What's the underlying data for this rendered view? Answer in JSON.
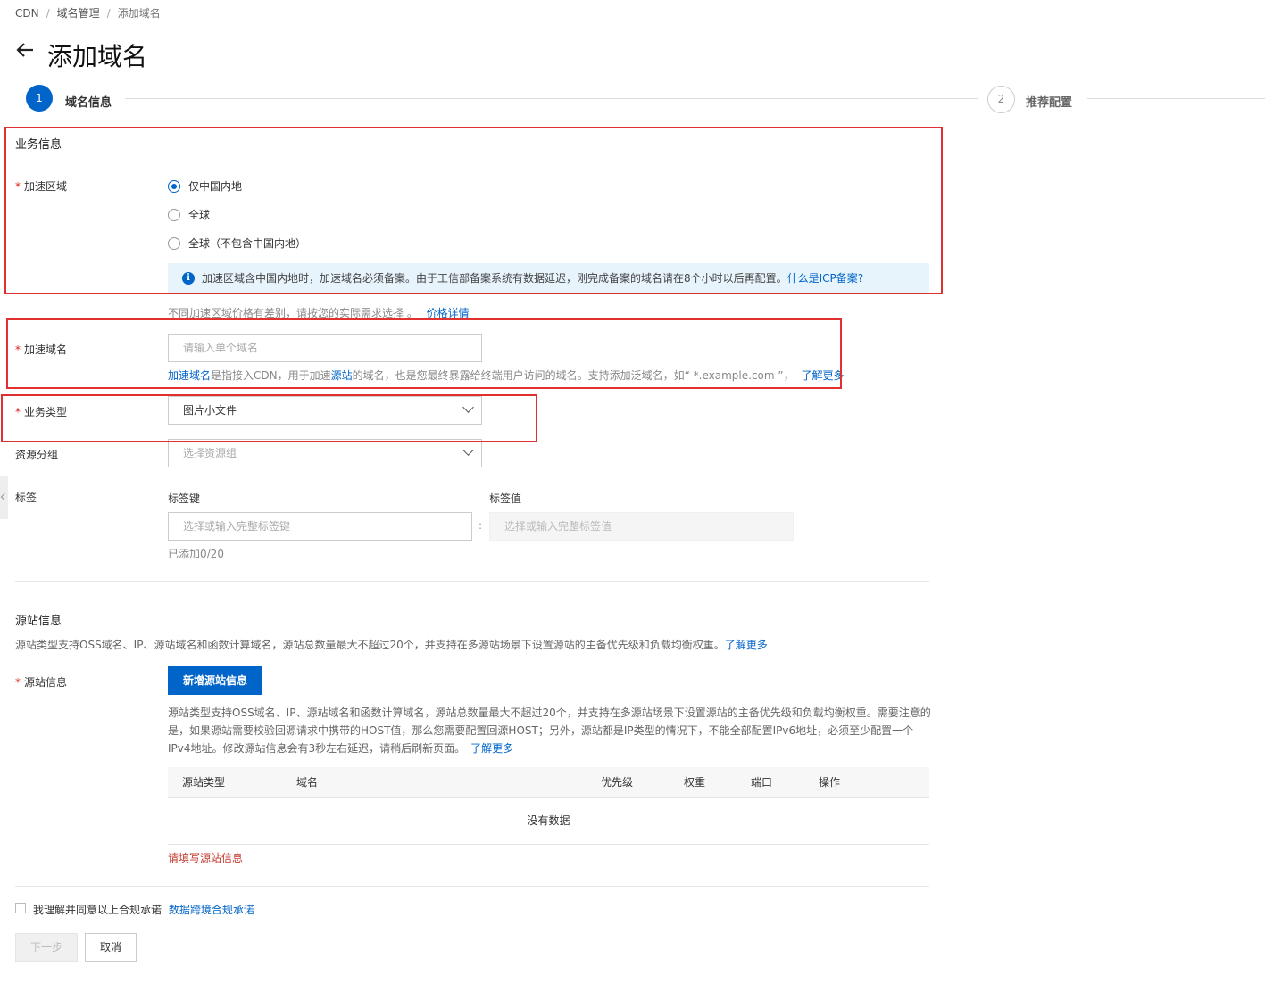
{
  "breadcrumb": [
    "CDN",
    "域名管理",
    "添加域名"
  ],
  "page": {
    "title": "添加域名"
  },
  "steps": [
    {
      "number": "1",
      "label": "域名信息",
      "active": true
    },
    {
      "number": "2",
      "label": "推荐配置",
      "active": false
    }
  ],
  "business": {
    "section_title": "业务信息",
    "region": {
      "label": "加速区域",
      "options": [
        "仅中国内地",
        "全球",
        "全球（不包含中国内地）"
      ],
      "selected": "仅中国内地",
      "info_text": "加速区域含中国内地时，加速域名必须备案。由于工信部备案系统有数据延迟，刚完成备案的域名请在8个小时以后再配置。",
      "info_link": "什么是ICP备案?",
      "price_hint": "不同加速区域价格有差别，请按您的实际需求选择 。",
      "price_link": "价格详情"
    },
    "domain": {
      "label": "加速域名",
      "placeholder": "请输入单个域名",
      "hint_link1": "加速域名",
      "hint_part1": "是指接入CDN，用于加速",
      "hint_link2": "源站",
      "hint_part2": "的域名，也是您最终暴露给终端用户访问的域名。支持添加泛域名，如“ *.example.com ”，",
      "hint_more": "了解更多"
    },
    "business_type": {
      "label": "业务类型",
      "value": "图片小文件"
    },
    "resource_group": {
      "label": "资源分组",
      "placeholder": "选择资源组"
    },
    "tags": {
      "label": "标签",
      "key_label": "标签键",
      "value_label": "标签值",
      "key_placeholder": "选择或输入完整标签键",
      "value_placeholder": "选择或输入完整标签值",
      "separator": ":",
      "count_text": "已添加0/20"
    }
  },
  "origin": {
    "section_title": "源站信息",
    "desc": "源站类型支持OSS域名、IP、源站域名和函数计算域名，源站总数量最大不超过20个，并支持在多源站场景下设置源站的主备优先级和负载均衡权重。",
    "desc_link": "了解更多",
    "label": "源站信息",
    "add_button": "新增源站信息",
    "detail_line1": "源站类型支持OSS域名、IP、源站域名和函数计算域名，源站总数量最大不超过20个，并支持在多源站场景下设置源站的主备优先级和负载均衡权重。需要注意的",
    "detail_line2": "是，如果源站需要校验回源请求中携带的HOST值，那么您需要配置回源HOST；另外，源站都是IP类型的情况下，不能全部配置IPv6地址，必须至少配置一个",
    "detail_line3": "IPv4地址。修改源站信息会有3秒左右延迟，请稍后刷新页面。",
    "detail_link": "了解更多",
    "table_headers": [
      "源站类型",
      "域名",
      "优先级",
      "权重",
      "端口",
      "操作"
    ],
    "empty_text": "没有数据",
    "error_text": "请填写源站信息"
  },
  "agreement": {
    "text": "我理解并同意以上合规承诺",
    "link": "数据跨境合规承诺"
  },
  "actions": {
    "next": "下一步",
    "cancel": "取消"
  },
  "colors": {
    "primary": "#0064c8",
    "highlight_border": "#e03030",
    "required": "#e02020",
    "error": "#c0392b"
  }
}
